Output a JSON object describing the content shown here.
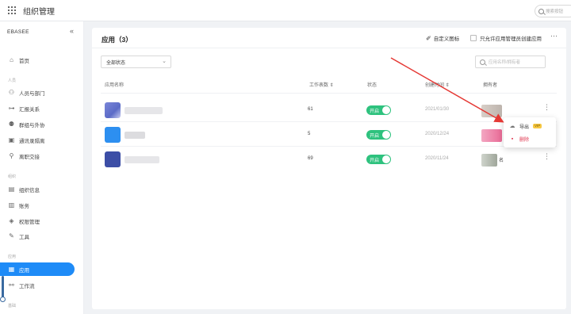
{
  "topbar": {
    "title": "组织管理",
    "search_placeholder": "搜索按钮"
  },
  "sidebar": {
    "org_name": "EBASEE",
    "collapse_icon": "double-chevron-left-icon",
    "groups": [
      {
        "label": "人员"
      },
      {
        "label": "组织"
      },
      {
        "label": "应用"
      },
      {
        "label": "基础"
      }
    ],
    "items": [
      {
        "label": "首页",
        "icon": "home-icon"
      },
      {
        "label": "人员与部门",
        "icon": "users-icon"
      },
      {
        "label": "汇报关系",
        "icon": "hierarchy-icon"
      },
      {
        "label": "群组与外协",
        "icon": "group-icon"
      },
      {
        "label": "通讯录隔离",
        "icon": "contact-book-icon"
      },
      {
        "label": "离职交接",
        "icon": "handover-icon"
      },
      {
        "label": "组织信息",
        "icon": "org-info-icon"
      },
      {
        "label": "账务",
        "icon": "billing-icon"
      },
      {
        "label": "权限管理",
        "icon": "permission-icon"
      },
      {
        "label": "工具",
        "icon": "wrench-icon"
      },
      {
        "label": "应用",
        "icon": "apps-icon",
        "active": true
      },
      {
        "label": "工作流",
        "icon": "workflow-icon"
      }
    ]
  },
  "main": {
    "title": "应用（3）",
    "custom_icon_label": "自定义图标",
    "only_admin_label": "只允许应用管理员创建应用",
    "more_icon": "more-horizontal-icon",
    "status_filter": {
      "value": "全部状态"
    },
    "search_placeholder": "应用名称/拥有者",
    "columns": [
      "应用名称",
      "工作表数 ⇕",
      "状态",
      "创建时间 ⇕",
      "拥有者"
    ],
    "rows": [
      {
        "sheets": "61",
        "status": "开启",
        "created": "2021/01/30",
        "owner": "",
        "icon_color": "#5b6bc7"
      },
      {
        "sheets": "5",
        "status": "开启",
        "created": "2020/12/24",
        "owner": "",
        "icon_color": "#2d8ff0"
      },
      {
        "sheets": "69",
        "status": "开启",
        "created": "2020/11/24",
        "owner": "名",
        "icon_color": "#3c4ea6"
      }
    ],
    "row_menu": {
      "export_label": "导出",
      "export_badge": "VIP",
      "delete_label": "删除"
    }
  },
  "colors": {
    "accent": "#1e8bf7",
    "toggle_on": "#2ec27e",
    "danger": "#e0364f",
    "annotation": "#e53935"
  }
}
